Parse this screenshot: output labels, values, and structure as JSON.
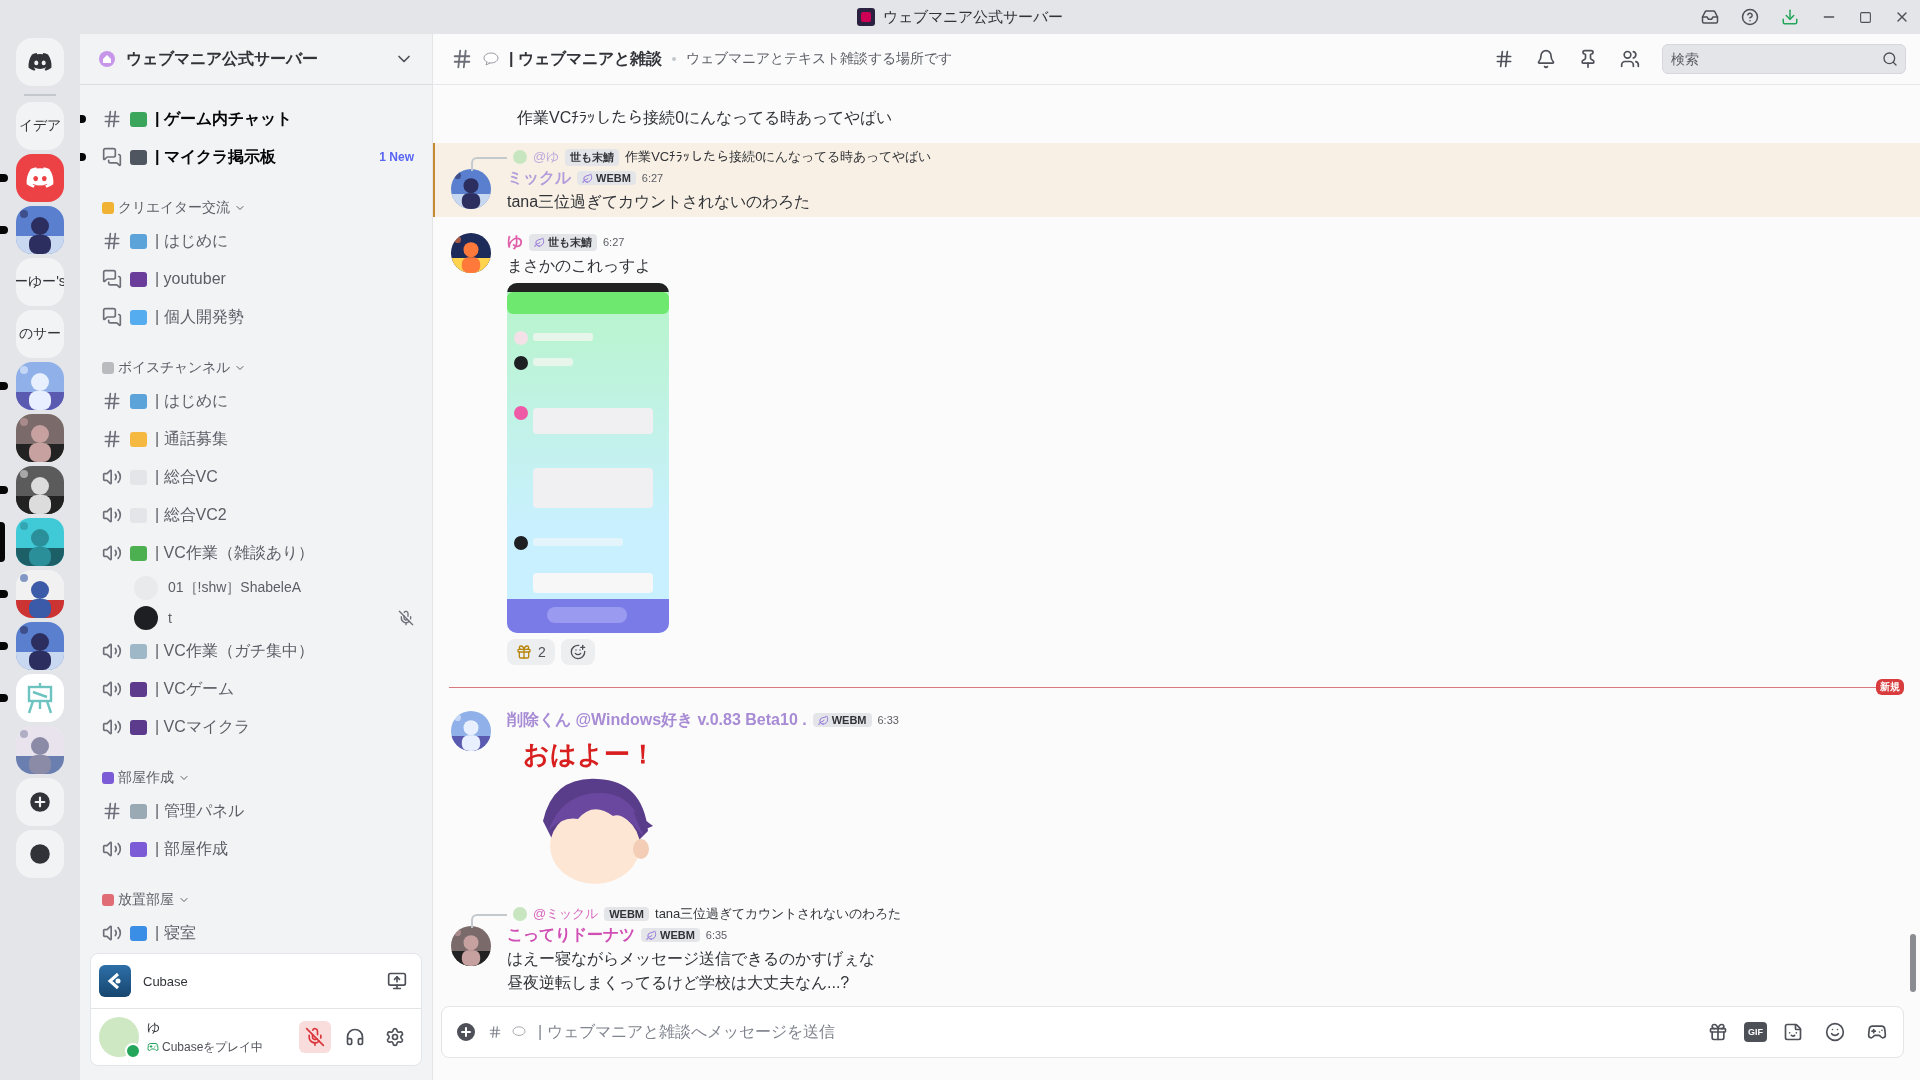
{
  "titlebar": {
    "title": "ウェブマニア公式サーバー"
  },
  "servers": [
    {
      "kind": "home",
      "unread": false,
      "selected": false
    },
    {
      "kind": "text",
      "label": "イデア",
      "unread": false,
      "selected": false
    },
    {
      "kind": "logo",
      "color": "#ed4245",
      "unread": true,
      "selected": false
    },
    {
      "kind": "picture",
      "unread": true,
      "selected": false
    },
    {
      "kind": "text",
      "label": "ーゆー's",
      "unread": false,
      "selected": false
    },
    {
      "kind": "text",
      "label": "のサー",
      "unread": false,
      "selected": false
    },
    {
      "kind": "picture",
      "unread": true,
      "selected": false
    },
    {
      "kind": "picture",
      "unread": false,
      "selected": false
    },
    {
      "kind": "picture",
      "unread": true,
      "selected": false
    },
    {
      "kind": "picture",
      "unread": false,
      "selected": true
    },
    {
      "kind": "picture",
      "unread": true,
      "selected": false
    },
    {
      "kind": "picture",
      "unread": true,
      "selected": false
    },
    {
      "kind": "easel",
      "unread": true,
      "selected": false
    },
    {
      "kind": "picture",
      "unread": false,
      "selected": false
    },
    {
      "kind": "add",
      "unread": false,
      "selected": false
    },
    {
      "kind": "discover",
      "unread": false,
      "selected": false
    }
  ],
  "channel_panel": {
    "server_name": "ウェブマニア公式サーバー",
    "channels": [
      {
        "kind": "text",
        "name": "| ゲーム内チャット",
        "color": "#3ba55c",
        "unread": true
      },
      {
        "kind": "forum",
        "name": "| マイクラ掲示板",
        "color": "#4f5660",
        "unread": true,
        "badge": "1 New"
      }
    ],
    "categories": [
      {
        "name": "クリエイター交流",
        "color": "#f0b232",
        "expanded": true,
        "channels": [
          {
            "kind": "text",
            "name": "| はじめに",
            "color": "#5ba3d9",
            "unread": false
          },
          {
            "kind": "forum",
            "name": "| youtuber",
            "color": "#6a3d9a",
            "unread": false
          },
          {
            "kind": "forum",
            "name": "| 個人開発勢",
            "color": "#55acee",
            "unread": false
          }
        ]
      },
      {
        "name": "ボイスチャンネル",
        "color": "#b9bbbe",
        "expanded": true,
        "channels": [
          {
            "kind": "text",
            "name": "| はじめに",
            "color": "#5ba3d9",
            "unread": false
          },
          {
            "kind": "text",
            "name": "| 通話募集",
            "color": "#f5b942",
            "unread": false
          },
          {
            "kind": "voice",
            "name": "| 総合VC",
            "color": "#e3e5e8",
            "unread": false
          },
          {
            "kind": "voice",
            "name": "| 総合VC2",
            "color": "#e3e5e8",
            "unread": false
          },
          {
            "kind": "voice",
            "name": "| VC作業（雑談あり）",
            "color": "#4caf50",
            "unread": false,
            "members": [
              {
                "name": "01［!shw］ShabeleA",
                "muted": false
              },
              {
                "name": "t",
                "muted": true
              }
            ]
          },
          {
            "kind": "voice",
            "name": "| VC作業（ガチ集中）",
            "color": "#9fb8c8",
            "unread": false
          },
          {
            "kind": "voice",
            "name": "| VCゲーム",
            "color": "#5c3b8c",
            "unread": false
          },
          {
            "kind": "voice",
            "name": "| VCマイクラ",
            "color": "#5c3b8c",
            "unread": false
          }
        ]
      },
      {
        "name": "部屋作成",
        "color": "#7b5cd6",
        "expanded": true,
        "channels": [
          {
            "kind": "text",
            "name": "| 管理パネル",
            "color": "#99aab5",
            "unread": false
          },
          {
            "kind": "voice",
            "name": "| 部屋作成",
            "color": "#7b5cd6",
            "unread": false
          }
        ]
      },
      {
        "name": "放置部屋",
        "color": "#e06c75",
        "expanded": true,
        "channels": [
          {
            "kind": "voice",
            "name": "| 寝室",
            "color": "#3a8ee6",
            "unread": false
          }
        ]
      }
    ]
  },
  "activity": {
    "name": "Cubase"
  },
  "user": {
    "name": "ゆ",
    "status": "Cubaseをプレイ中",
    "online": true,
    "muted": true
  },
  "chat_header": {
    "channel": "| ウェブマニアと雑談",
    "topic": "ウェブマニアとテキスト雑談する場所です",
    "search_placeholder": "検索"
  },
  "messages": [
    {
      "kind": "continuation",
      "lines": [
        "作業VCﾁﾗｯしたら接続0にんなってる時あってやばい"
      ]
    },
    {
      "kind": "message",
      "highlighted": true,
      "reply": {
        "author": "@ゆ",
        "tag": "世も末鯖",
        "text": "作業VCﾁﾗｯしたら接続0にんなってる時あってやばい"
      },
      "author": "ミックル",
      "color": "#b39ddb",
      "tag": "WEBM",
      "time": "6:27",
      "lines": [
        "tana三位過ぎてカウントされないのわろた"
      ]
    },
    {
      "kind": "message",
      "highlighted": false,
      "author": "ゆ",
      "color": "#e05fa8",
      "tag": "世も末鯖",
      "time": "6:27",
      "lines": [
        "まさかのこれっすよ"
      ],
      "attachment": {
        "kind": "picture"
      },
      "reactions": [
        {
          "count": "2",
          "mine": false
        }
      ]
    },
    {
      "kind": "divider",
      "label": "新規"
    },
    {
      "kind": "message",
      "highlighted": false,
      "author": "削除くん @Windows好き v.0.83 Beta10 .",
      "color": "#a78bd4",
      "tag": "WEBM",
      "time": "6:33",
      "sticker": {
        "caption": "おはよー！"
      }
    },
    {
      "kind": "message",
      "highlighted": false,
      "reply": {
        "author": "@ミックル",
        "tag": "WEBM",
        "text": "tana三位過ぎてカウントされないのわろた"
      },
      "author": "こってりドーナツ",
      "color": "#d14fb5",
      "tag": "WEBM",
      "time": "6:35",
      "lines": [
        "はえー寝ながらメッセージ送信できるのかすげぇな",
        "昼夜逆転しまくってるけど学校は大丈夫なん...?"
      ]
    }
  ],
  "composer": {
    "placeholder": "| ウェブマニアと雑談へメッセージを送信",
    "gif_label": "GIF"
  }
}
